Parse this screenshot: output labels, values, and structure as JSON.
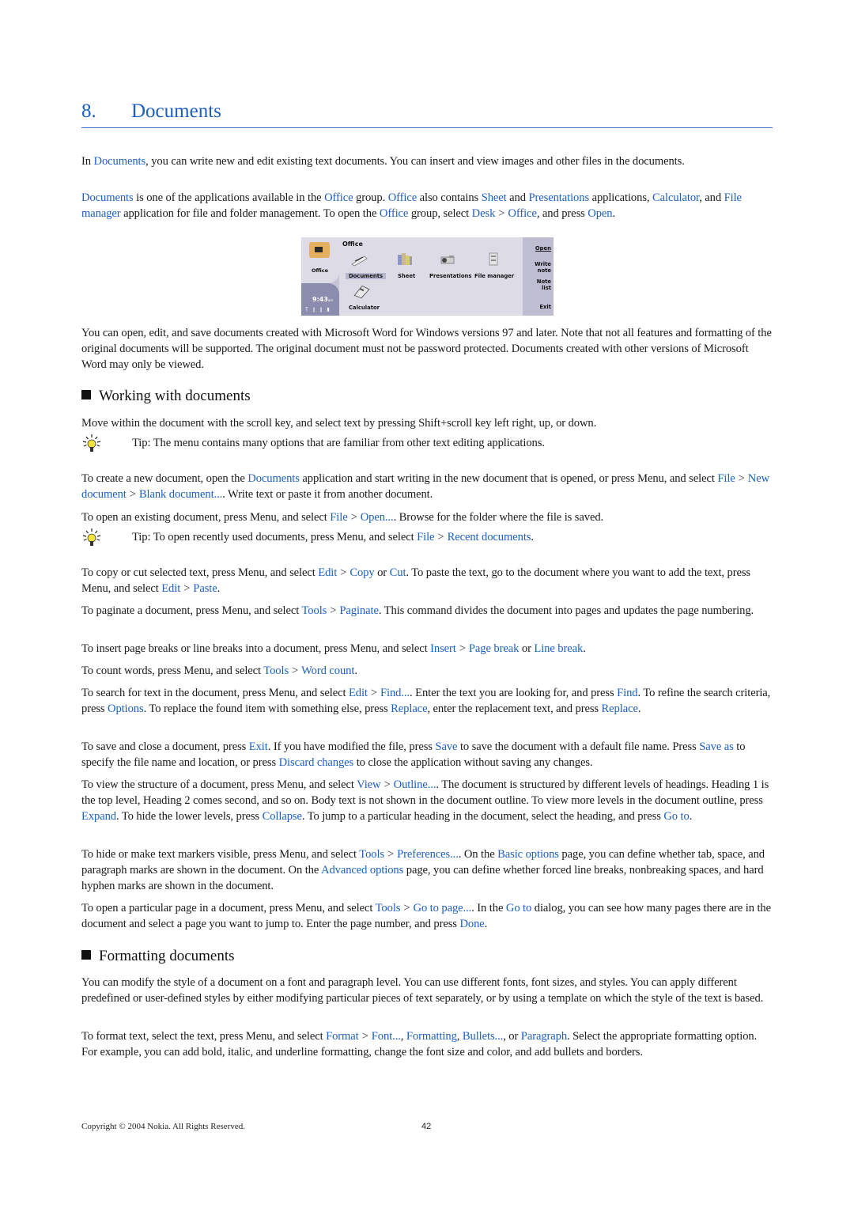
{
  "chapter": {
    "number": "8.",
    "title": "Documents"
  },
  "intro": {
    "p1": {
      "a": "In ",
      "l1": "Documents",
      "b": ", you can write new and edit existing text documents. You can insert and view images and other files in the documents."
    },
    "p2": {
      "l1": "Documents",
      "a": " is one of the applications available in the ",
      "l2": "Office",
      "b": " group. ",
      "l3": "Office",
      "c": " also contains ",
      "l4": "Sheet",
      "d": " and ",
      "l5": "Presentations",
      "e": " applications, ",
      "l6": "Calculator",
      "f": ", and ",
      "l7": "File manager",
      "g": " application for file and folder management. To open the ",
      "l8": "Office",
      "h": " group, select ",
      "l9": "Desk",
      "sep": ">",
      "l10": "Office",
      "i": ", and press ",
      "l11": "Open",
      "j": "."
    }
  },
  "screenshot": {
    "side_label": "Office",
    "clock": "9:43",
    "clock_suffix": "am",
    "signal": "T ∥ ∥ ▮",
    "group_title": "Office",
    "apps": [
      "Documents",
      "Sheet",
      "Presentations",
      "File manager",
      "Calculator"
    ],
    "commands": [
      "Open",
      "Write note",
      "Note list",
      "Exit"
    ]
  },
  "compat": "You can open, edit, and save documents created with Microsoft Word for Windows versions 97 and later. Note that not all features and formatting of the original documents will be supported. The original document must not be password protected. Documents created with other versions of Microsoft Word may only be viewed.",
  "section1": {
    "title": "Working with documents",
    "move": "Move within the document with the scroll key, and select text by pressing Shift+scroll key left right, up, or down.",
    "tip1": {
      "label": "Tip:",
      "text": " The menu contains many options that are familiar from other text editing applications."
    },
    "create": {
      "a": "To create a new document, open the ",
      "l1": "Documents",
      "b": " application and start writing in the new document that is opened, or press Menu, and select ",
      "l2": "File",
      "l3": "New document",
      "l4": "Blank document...",
      "c": ". Write text or paste it from another document."
    },
    "open": {
      "a": "To open an existing document, press Menu, and select ",
      "l1": "File",
      "l2": "Open...",
      "b": ". Browse for the folder where the file is saved."
    },
    "tip2": {
      "label": "Tip:",
      "a": " To open recently used documents, press Menu, and select ",
      "l1": "File",
      "l2": "Recent documents",
      "b": "."
    },
    "copy": {
      "a": "To copy or cut selected text, press Menu, and select ",
      "l1": "Edit",
      "l2": "Copy",
      "b": " or ",
      "l3": "Cut",
      "c": ". To paste the text, go to the document where you want to add the text, press Menu, and select ",
      "l4": "Edit",
      "l5": "Paste",
      "d": "."
    },
    "paginate": {
      "a": "To paginate a document, press Menu, and select ",
      "l1": "Tools",
      "l2": "Paginate",
      "b": ". This command divides the document into pages and updates the page numbering."
    },
    "breaks": {
      "a": "To insert page breaks or line breaks into a document, press Menu, and select ",
      "l1": "Insert",
      "l2": "Page break",
      "b": " or ",
      "l3": "Line break",
      "c": "."
    },
    "count": {
      "a": "To count words, press Menu, and select ",
      "l1": "Tools",
      "l2": "Word count",
      "b": "."
    },
    "search": {
      "a": "To search for text in the document, press Menu, and select ",
      "l1": "Edit",
      "l2": "Find...",
      "b": ". Enter the text you are looking for, and press ",
      "l3": "Find",
      "c": ". To refine the search criteria, press ",
      "l4": "Options",
      "d": ". To replace the found item with something else, press ",
      "l5": "Replace",
      "e": ", enter the replacement text, and press ",
      "l6": "Replace",
      "f": "."
    },
    "save": {
      "a": "To save and close a document, press ",
      "l1": "Exit",
      "b": ". If you have modified the file, press ",
      "l2": "Save",
      "c": " to save the document with a default file name. Press ",
      "l3": "Save as",
      "d": " to specify the file name and location, or press ",
      "l4": "Discard changes",
      "e": " to close the application without saving any changes."
    },
    "outline": {
      "a": "To view the structure of a document, press Menu, and select ",
      "l1": "View",
      "l2": "Outline...",
      "b": ". The document is structured by different levels of headings. Heading 1 is the top level, Heading 2 comes second, and so on. Body text is not shown in the document outline. To view more levels in the document outline, press ",
      "l3": "Expand",
      "c": ". To hide the lower levels, press ",
      "l4": "Collapse",
      "d": ". To jump to a particular heading in the document, select the heading, and press ",
      "l5": "Go to",
      "e": "."
    },
    "markers": {
      "a": "To hide or make text markers visible, press Menu, and select ",
      "l1": "Tools",
      "l2": "Preferences...",
      "b": ". On the ",
      "l3": "Basic options",
      "c": " page, you can define whether tab, space, and paragraph marks are shown in the document. On the ",
      "l4": "Advanced options",
      "d": " page, you can define whether forced line breaks, nonbreaking spaces, and hard hyphen marks are shown in the document."
    },
    "goto": {
      "a": "To open a particular page in a document, press Menu, and select ",
      "l1": "Tools",
      "l2": "Go to page...",
      "b": ". In the ",
      "l3": "Go to",
      "c": " dialog, you can see how many pages there are in the document and select a page you want to jump to. Enter the page number, and press ",
      "l4": "Done",
      "d": "."
    }
  },
  "section2": {
    "title": "Formatting documents",
    "style": "You can modify the style of a document on a font and paragraph level. You can use different fonts, font sizes, and styles. You can apply different predefined or user-defined styles by either modifying particular pieces of text separately, or by using a template on which the style of the text is based.",
    "format": {
      "a": "To format text, select the text, press Menu, and select ",
      "l1": "Format",
      "l2": "Font...",
      "b": ", ",
      "l3": "Formatting",
      "c": ", ",
      "l4": "Bullets...",
      "d": ", or ",
      "l5": "Paragraph",
      "e": ". Select the appropriate formatting option. For example, you can add bold, italic, and underline formatting, change the font size and color, and add bullets and borders."
    }
  },
  "sep": ">",
  "footer": {
    "copyright": "Copyright © 2004 Nokia. All Rights Reserved.",
    "page": "42"
  },
  "colors": {
    "link": "#1c5fbf",
    "heading": "#1c5fbf",
    "rule": "#3a6fc4"
  }
}
